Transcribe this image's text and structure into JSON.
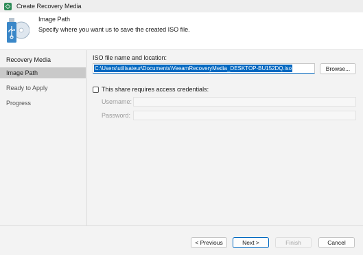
{
  "window": {
    "title": "Create Recovery Media"
  },
  "header": {
    "step_title": "Image Path",
    "step_description": "Specify where you want us to save the created ISO file.",
    "icon": "usb-drive-disc-icon"
  },
  "sidebar": {
    "items": [
      {
        "label": "Recovery Media",
        "state": "normal"
      },
      {
        "label": "Image Path",
        "state": "active"
      },
      {
        "label": "Ready to Apply",
        "state": "dim"
      },
      {
        "label": "Progress",
        "state": "dim"
      }
    ]
  },
  "content": {
    "iso_label": "ISO file name and location:",
    "iso_value": "C:\\Users\\utilisateur\\Documents\\VeeamRecoveryMedia_DESKTOP-BU152DQ.iso",
    "browse_label": "Browse...",
    "credentials_label": "This share requires access credentials:",
    "credentials_checked": false,
    "username_label": "Username:",
    "username_value": "",
    "password_label": "Password:",
    "password_value": ""
  },
  "footer": {
    "previous_label": "< Previous",
    "next_label": "Next >",
    "finish_label": "Finish",
    "cancel_label": "Cancel"
  },
  "colors": {
    "accent": "#0067c0",
    "app_icon": "#2e8b57",
    "selected_nav": "#c9c9c9",
    "hero_icon": "#3a87c8"
  }
}
